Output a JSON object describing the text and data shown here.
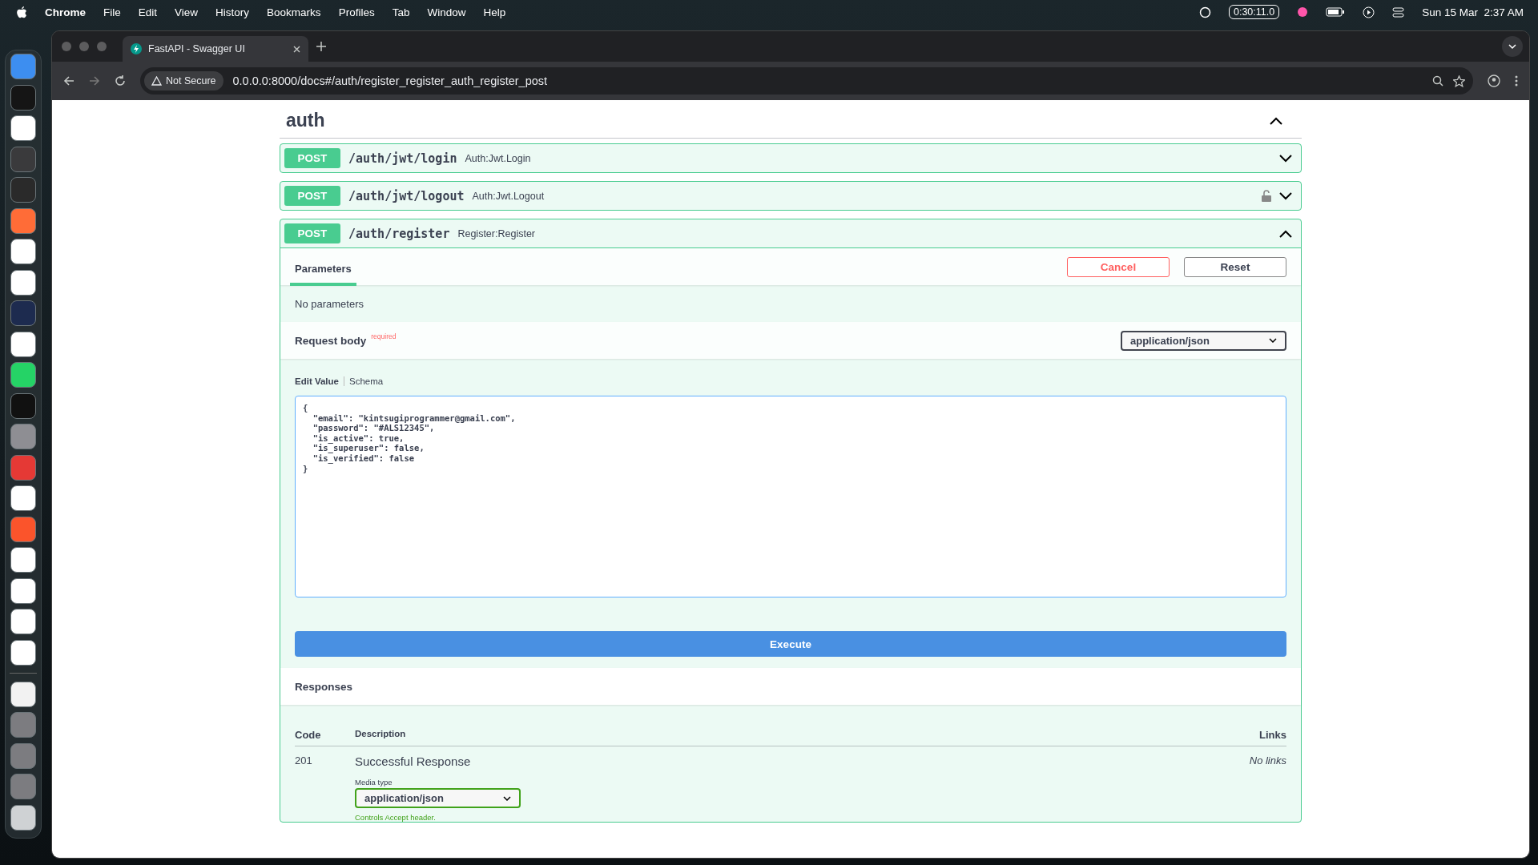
{
  "menubar": {
    "app": "Chrome",
    "menus": [
      "File",
      "Edit",
      "View",
      "History",
      "Bookmarks",
      "Profiles",
      "Tab",
      "Window",
      "Help"
    ],
    "timer": "0:30:11.0",
    "clock": "Sun 15 Mar  2:37 AM"
  },
  "browser": {
    "tab": {
      "title": "FastAPI - Swagger UI"
    },
    "security": "Not Secure",
    "url": "0.0.0.0:8000/docs#/auth/register_register_auth_register_post"
  },
  "section": {
    "title": "auth",
    "expanded": true
  },
  "operations": [
    {
      "method": "POST",
      "path": "/auth/jwt/login",
      "summary": "Auth:Jwt.Login",
      "locked": false,
      "expanded": false
    },
    {
      "method": "POST",
      "path": "/auth/jwt/logout",
      "summary": "Auth:Jwt.Logout",
      "locked": true,
      "expanded": false
    },
    {
      "method": "POST",
      "path": "/auth/register",
      "summary": "Register:Register",
      "locked": false,
      "expanded": true
    }
  ],
  "try_out": {
    "tabs": [
      {
        "label": "Parameters",
        "selected": true
      }
    ],
    "cancel": "Cancel",
    "reset": "Reset",
    "no_params": "No parameters",
    "request_body": {
      "label": "Request body",
      "required": "required",
      "content_type": "application/json"
    },
    "editor_tabs": [
      {
        "label": "Edit Value",
        "selected": true
      },
      {
        "label": "Schema",
        "selected": false
      }
    ],
    "body": "{\n  \"email\": \"kintsugiprogrammer@gmail.com\",\n  \"password\": \"#ALS12345\",\n  \"is_active\": true,\n  \"is_superuser\": false,\n  \"is_verified\": false\n}",
    "execute": "Execute"
  },
  "responses": {
    "title": "Responses",
    "columns": [
      "Code",
      "Description",
      "Links"
    ],
    "rows": [
      {
        "code": "201",
        "description": "Successful Response",
        "links": "No links",
        "media_type_label": "Media type",
        "media_type": "application/json",
        "hint": "Controls Accept header."
      }
    ]
  }
}
